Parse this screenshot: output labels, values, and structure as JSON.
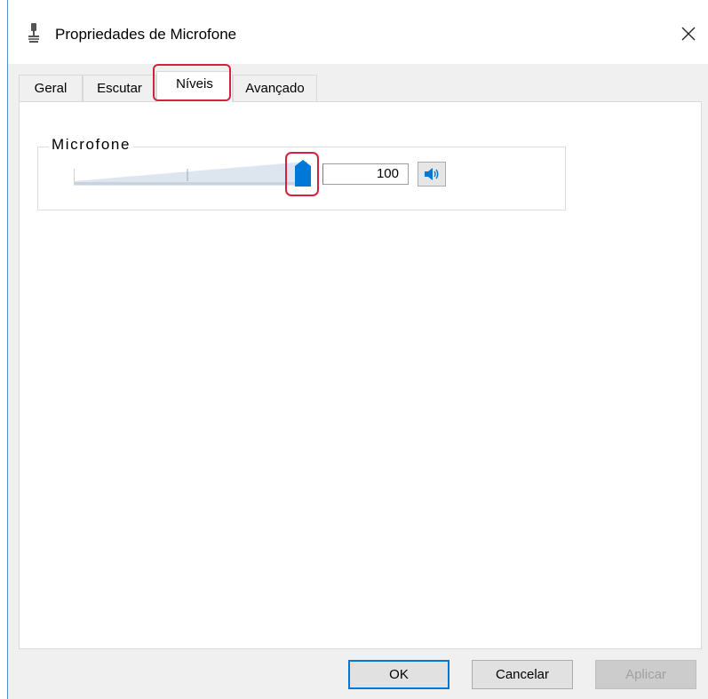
{
  "window": {
    "title": "Propriedades de Microfone",
    "close_glyph": "×"
  },
  "tabs": [
    {
      "label": "Geral"
    },
    {
      "label": "Escutar"
    },
    {
      "label": "Níveis"
    },
    {
      "label": "Avançado"
    }
  ],
  "levels": {
    "group_label": "Microfone",
    "value": "100",
    "slider_level_percent": 100
  },
  "buttons": {
    "ok": "OK",
    "cancel": "Cancelar",
    "apply": "Aplicar"
  },
  "colors": {
    "accent": "#0078d7",
    "highlight": "#d4213d"
  },
  "icons": {
    "title": "microphone-icon",
    "close": "close-icon",
    "mute": "speaker-icon",
    "thumb": "slider-thumb"
  }
}
